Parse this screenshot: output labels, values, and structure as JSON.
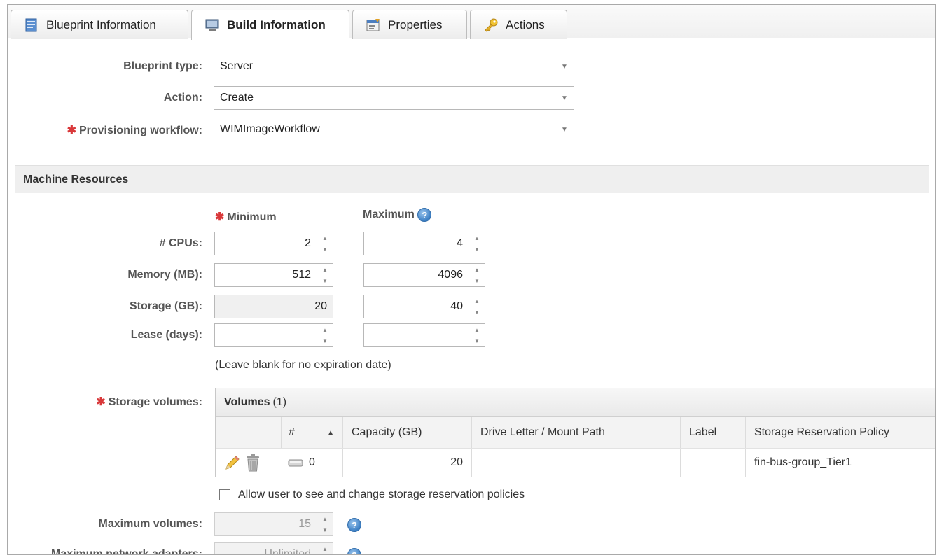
{
  "tabs": [
    {
      "label": "Blueprint Information",
      "icon": "blueprint-icon"
    },
    {
      "label": "Build Information",
      "icon": "server-icon",
      "active": true
    },
    {
      "label": "Properties",
      "icon": "properties-icon"
    },
    {
      "label": "Actions",
      "icon": "key-icon"
    }
  ],
  "form": {
    "blueprint_type": {
      "label": "Blueprint type:",
      "value": "Server"
    },
    "action": {
      "label": "Action:",
      "value": "Create"
    },
    "workflow": {
      "label": "Provisioning workflow:",
      "value": "WIMImageWorkflow"
    }
  },
  "section": {
    "title": "Machine Resources"
  },
  "resources": {
    "min_header": "Minimum",
    "max_header": "Maximum",
    "rows": [
      {
        "label": "# CPUs:",
        "min": "2",
        "max": "4"
      },
      {
        "label": "Memory (MB):",
        "min": "512",
        "max": "4096"
      },
      {
        "label": "Storage (GB):",
        "min": "20",
        "max": "40"
      },
      {
        "label": "Lease (days):",
        "min": "",
        "max": ""
      }
    ],
    "lease_hint": "(Leave blank for no expiration date)"
  },
  "volumes": {
    "label": "Storage volumes:",
    "title": "Volumes",
    "count": "(1)",
    "columns": [
      "#",
      "Capacity (GB)",
      "Drive Letter / Mount Path",
      "Label",
      "Storage Reservation Policy"
    ],
    "rows": [
      {
        "index": "0",
        "capacity": "20",
        "mount": "",
        "label": "",
        "policy": "fin-bus-group_Tier1"
      }
    ]
  },
  "allow_change": {
    "label": "Allow user to see and change storage reservation policies",
    "checked": false
  },
  "max_volumes": {
    "label": "Maximum volumes:",
    "value": "15"
  },
  "max_network": {
    "label": "Maximum network adapters:",
    "value": "Unlimited"
  },
  "colors": {
    "required": "#d9383a",
    "help": "#3c7fc4"
  }
}
